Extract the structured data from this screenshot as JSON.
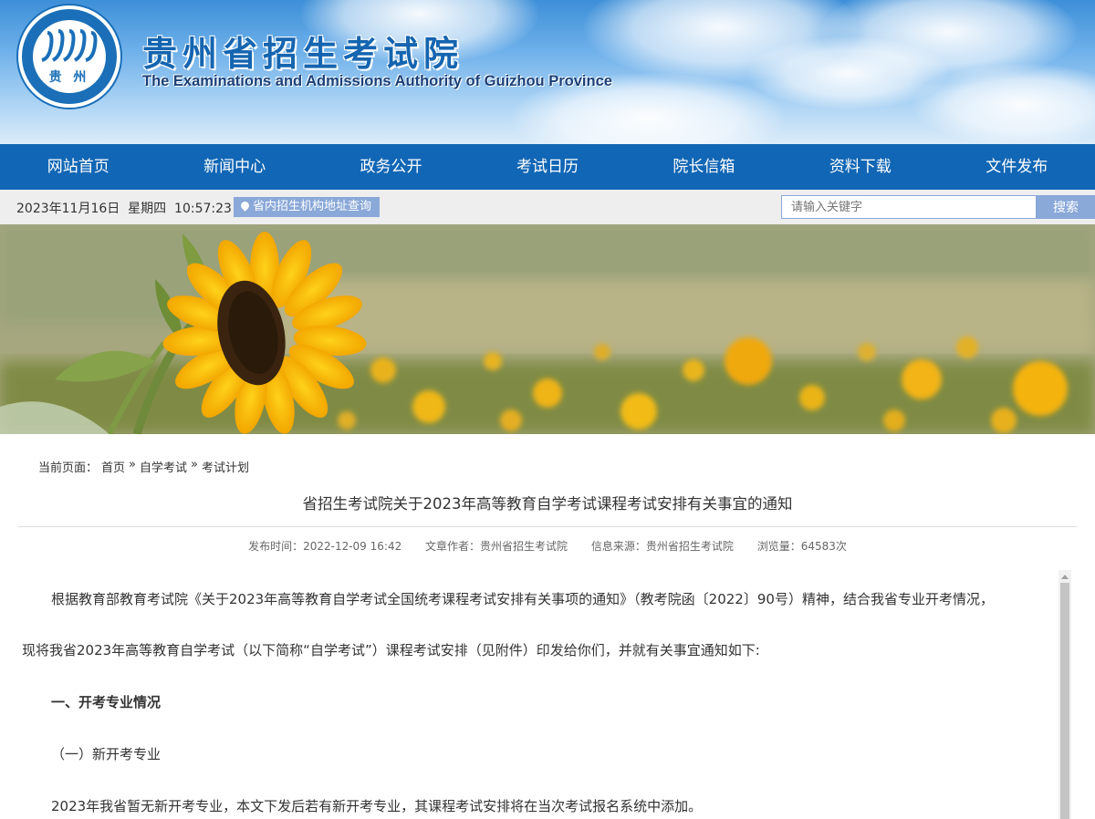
{
  "header": {
    "logo_text": "贵 州",
    "site_title_cn": "贵州省招生考试院",
    "site_title_en": "The Examinations and Admissions Authority of Guizhou Province"
  },
  "nav": {
    "items": [
      "网站首页",
      "新闻中心",
      "政务公开",
      "考试日历",
      "院长信箱",
      "资料下载",
      "文件发布"
    ]
  },
  "infobar": {
    "datetime": "2023年11月16日  星期四  10:57:23",
    "address_button": "省内招生机构地址查询",
    "search_placeholder": "请输入关键字",
    "search_button": "搜索"
  },
  "breadcrumb": {
    "prefix": "当前页面：",
    "items": [
      "首页",
      "自学考试",
      "考试计划"
    ],
    "separator": "»"
  },
  "article": {
    "title": "省招生考试院关于2023年高等教育自学考试课程考试安排有关事宜的通知",
    "meta": {
      "published": "发布时间：2022-12-09 16:42",
      "author": "文章作者：贵州省招生考试院",
      "source": "信息来源：贵州省招生考试院",
      "views": "浏览量：64583次"
    },
    "paragraphs": [
      "根据教育部教育考试院《关于2023年高等教育自学考试全国统考课程考试安排有关事项的通知》（教考院函〔2022〕90号）精神，结合我省专业开考情况，",
      "现将我省2023年高等教育自学考试（以下简称“自学考试”）课程考试安排（见附件）印发给你们，并就有关事宜通知如下:",
      "一、开考专业情况",
      "（一）新开考专业",
      "2023年我省暂无新开考专业，本文下发后若有新开考专业，其课程考试安排将在当次考试报名系统中添加。"
    ]
  }
}
